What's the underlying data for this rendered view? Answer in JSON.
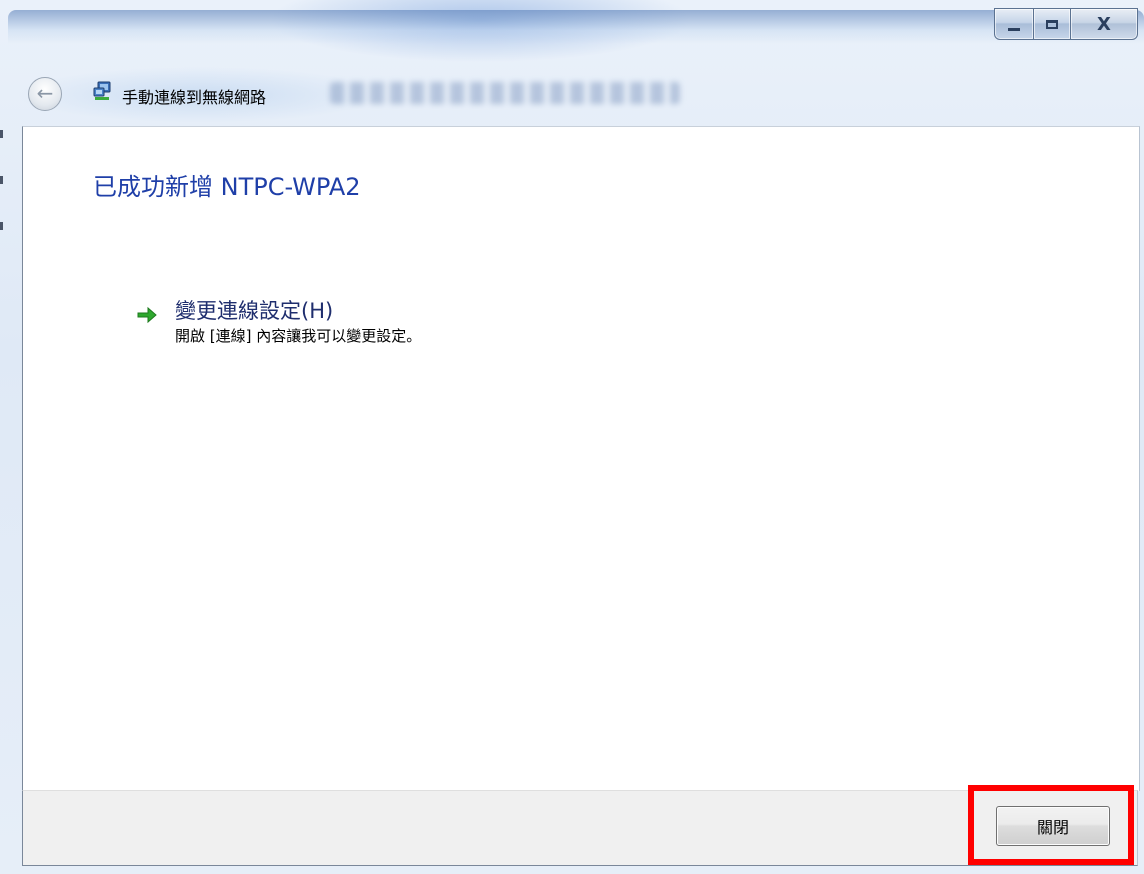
{
  "window": {
    "title": "手動連線到無線網路",
    "caption": {
      "minimize_icon": "minimize-icon",
      "maximize_icon": "maximize-icon",
      "close_glyph": "X"
    }
  },
  "nav": {
    "back_arrow": "←",
    "title": "手動連線到無線網路"
  },
  "content": {
    "heading": "已成功新增 NTPC-WPA2",
    "option": {
      "title": "變更連線設定(H)",
      "description": "開啟 [連線] 內容讓我可以變更設定。"
    }
  },
  "footer": {
    "close_label": "關閉"
  },
  "colors": {
    "heading": "#1f3fa8",
    "highlight": "#ff0000",
    "link": "#1f2e6e"
  }
}
